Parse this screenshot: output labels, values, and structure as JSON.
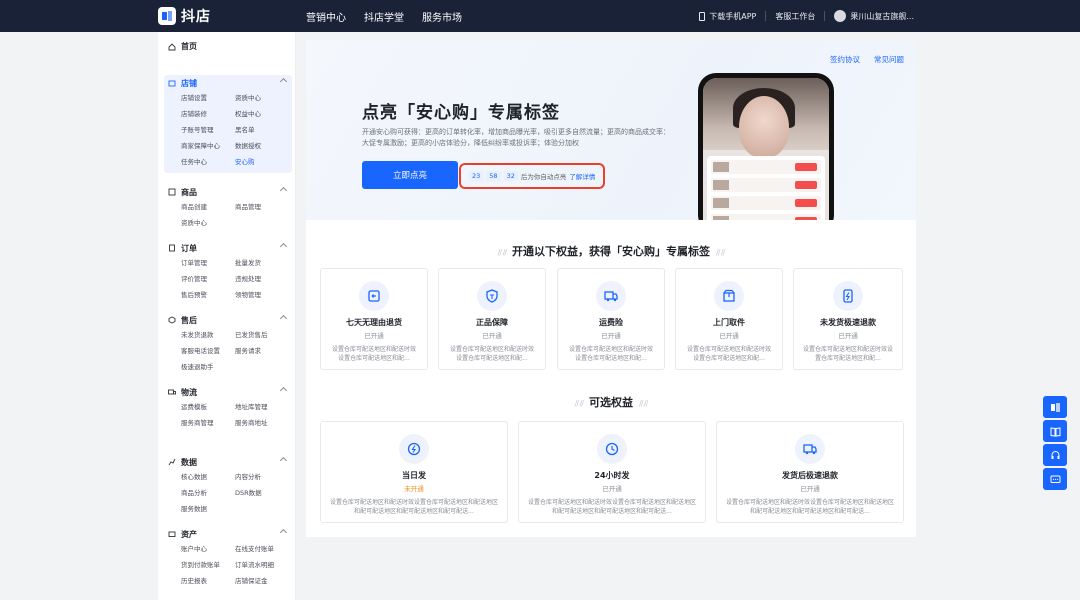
{
  "topbar": {
    "logo_text": "抖店",
    "nav": [
      "营销中心",
      "抖店学堂",
      "服务市场"
    ],
    "download_app": "下载手机APP",
    "service": "客服工作台",
    "shop_name": "果川山复古旗舰..."
  },
  "sidebar": {
    "home": "首页",
    "groups": [
      {
        "title": "店铺",
        "items": [
          "店铺设置",
          "资质中心",
          "店铺装修",
          "权益中心",
          "子账号管理",
          "黑名单",
          "商家保障中心",
          "数据授权",
          "任务中心",
          "安心购"
        ]
      },
      {
        "title": "商品",
        "items": [
          "商品创建",
          "商品管理",
          "资质中心"
        ]
      },
      {
        "title": "订单",
        "items": [
          "订单管理",
          "批量发货",
          "评价管理",
          "违规处理",
          "售后预警",
          "领物管理"
        ]
      },
      {
        "title": "售后",
        "items": [
          "未发货退款",
          "已发货售后",
          "客服电话设置",
          "服务请求",
          "极速退助手"
        ]
      },
      {
        "title": "物流",
        "items": [
          "运费模板",
          "地址库管理",
          "服务商管理",
          "服务商地址"
        ]
      },
      {
        "title": "数据",
        "items": [
          "核心数据",
          "内容分析",
          "商品分析",
          "DSR数据",
          "服务数据"
        ]
      },
      {
        "title": "资产",
        "items": [
          "账户中心",
          "在线支付账单",
          "货到付款账单",
          "订单流水明细",
          "历史报表",
          "店铺保证金"
        ]
      }
    ]
  },
  "hero": {
    "links": [
      "签约协议",
      "常见问题"
    ],
    "title": "点亮「安心购」专属标签",
    "desc": "开通安心购可获得：更高的订单转化率，增加商品曝光率，吸引更多自然流量；更高的商品成交率：大促专属激励；更高的小店体验分，降低纠纷率或投诉率；体验分加权",
    "button": "立即点亮",
    "countdown": {
      "h": "23",
      "m": "58",
      "s": "32",
      "text": "后为你自动点亮",
      "link": "了解详情"
    }
  },
  "required": {
    "title": "开通以下权益，获得「安心购」专属标签",
    "cards": [
      {
        "icon": "return-box-icon",
        "name": "七天无理由退货",
        "status": "已开通",
        "desc": "设置仓库可配送地区和配送时效设置仓库可配送地区和配..."
      },
      {
        "icon": "shield-genuine-icon",
        "name": "正品保障",
        "status": "已开通",
        "desc": "设置仓库可配送地区和配送时效设置仓库可配送地区和配..."
      },
      {
        "icon": "truck-icon",
        "name": "运费险",
        "status": "已开通",
        "desc": "设置仓库可配送地区和配送时效设置仓库可配送地区和配..."
      },
      {
        "icon": "package-pickup-icon",
        "name": "上门取件",
        "status": "已开通",
        "desc": "设置仓库可配送地区和配送时效设置仓库可配送地区和配..."
      },
      {
        "icon": "fast-refund-icon",
        "name": "未发货极速退款",
        "status": "已开通",
        "desc": "设置仓库可配送地区和配送时效设置仓库可配送地区和配..."
      }
    ]
  },
  "optional": {
    "title": "可选权益",
    "cards": [
      {
        "icon": "lightning-icon",
        "name": "当日发",
        "status": "未开通",
        "desc": "设置仓库可配送地区和配送时效设置仓库可配送地区和配送地区和配可配送地区和配可配送地区和配可配送..."
      },
      {
        "icon": "clock-icon",
        "name": "24小时发",
        "status": "已开通",
        "desc": "设置仓库可配送地区和配送时效设置仓库可配送地区和配送地区和配可配送地区和配可配送地区和配可配送..."
      },
      {
        "icon": "truck-refund-icon",
        "name": "发货后极速退款",
        "status": "已开通",
        "desc": "设置仓库可配送地区和配送时效设置仓库可配送地区和配送地区和配可配送地区和配可配送地区和配可配送..."
      }
    ]
  },
  "colors": {
    "accent": "#1966ff",
    "topbar": "#1a2238",
    "highlight": "#e8402f",
    "warn": "#f08c1a"
  }
}
